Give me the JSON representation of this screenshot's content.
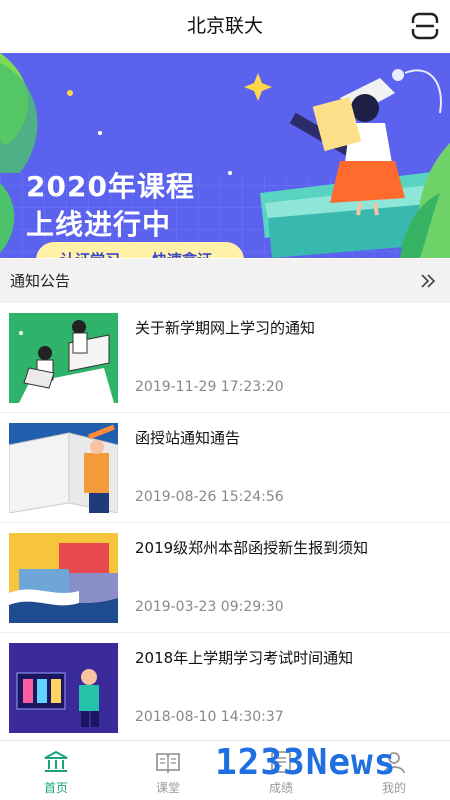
{
  "header": {
    "title": "北京联大",
    "scan_icon": "scan-icon"
  },
  "banner": {
    "line1": "2020年课程",
    "line2": "上线进行中",
    "tag1": "认证学习",
    "tag2": "快速拿证",
    "slides": 3,
    "active_slide": 3,
    "colors": {
      "bg": "#5b63ee",
      "accent": "#fff2a8"
    }
  },
  "notice": {
    "heading": "通知公告",
    "more_icon": "double-chevron-right-icon",
    "items": [
      {
        "title": "关于新学期网上学习的通知",
        "date": "2019-11-29 17:23:20"
      },
      {
        "title": "函授站通知通告",
        "date": "2019-08-26 15:24:56"
      },
      {
        "title": "2019级郑州本部函授新生报到须知",
        "date": "2019-03-23 09:29:30"
      },
      {
        "title": "2018年上学期学习考试时间通知",
        "date": "2018-08-10 14:30:37"
      }
    ]
  },
  "tabs": [
    {
      "label": "首页",
      "icon": "home-icon",
      "active": true
    },
    {
      "label": "课堂",
      "icon": "book-icon",
      "active": false
    },
    {
      "label": "成绩",
      "icon": "grades-icon",
      "active": false
    },
    {
      "label": "我的",
      "icon": "user-icon",
      "active": false
    }
  ],
  "watermark": "1233News",
  "colors": {
    "active_tab": "#1aa37a",
    "inactive_tab": "#999999",
    "date": "#888888"
  }
}
